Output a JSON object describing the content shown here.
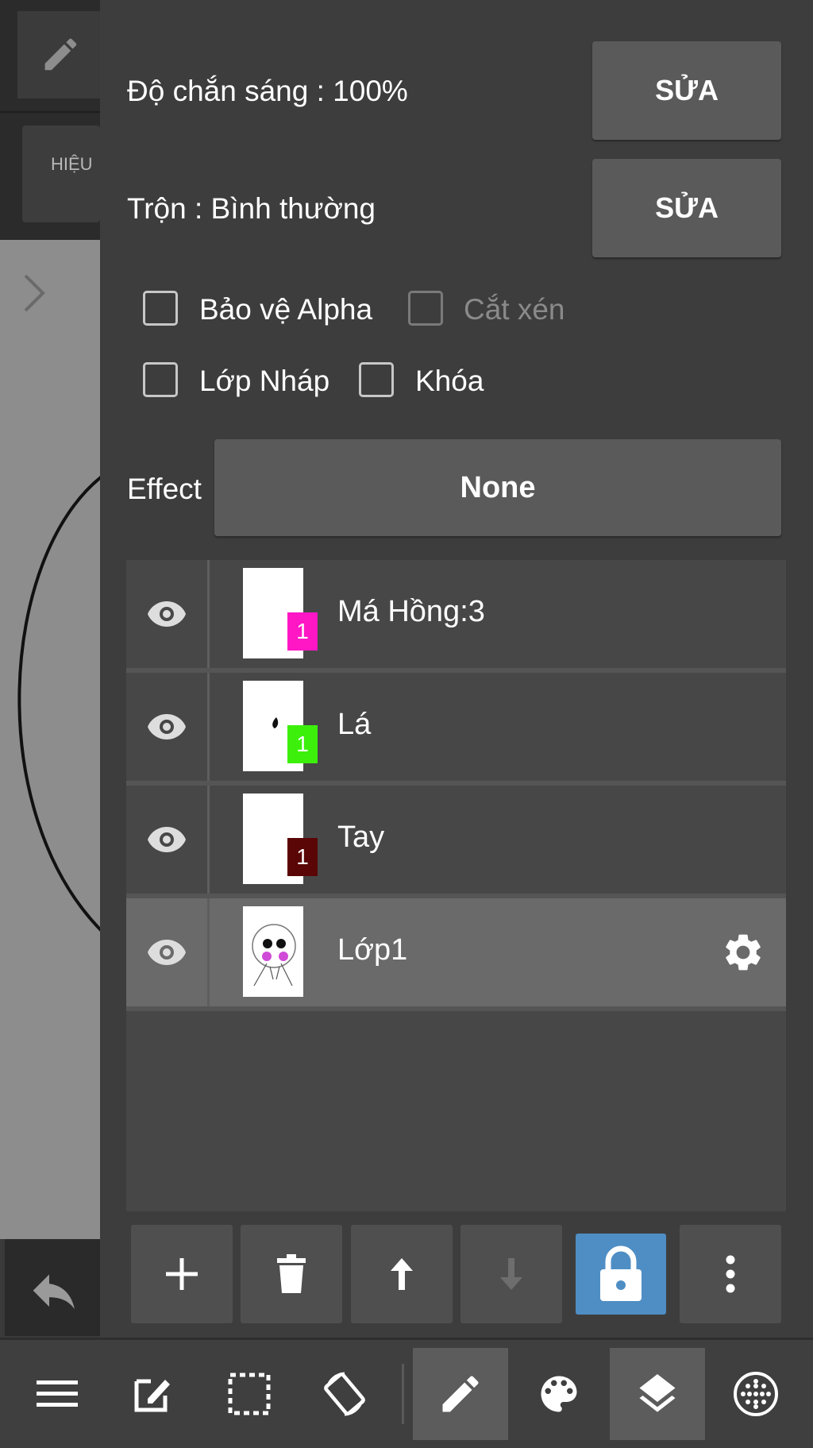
{
  "background": {
    "effect_tile_label": "HIỆU"
  },
  "properties": {
    "opacity_label": "Độ chắn sáng : 100%",
    "blend_label": "Trộn : Bình thường",
    "edit_button": "SỬA",
    "protect_alpha": "Bảo vệ Alpha",
    "clipping": "Cắt xén",
    "draft_layer": "Lớp Nháp",
    "lock": "Khóa",
    "effect_label": "Effect",
    "effect_value": "None"
  },
  "layers": [
    {
      "name": "Má Hồng:3",
      "badge": "1",
      "badge_color": "#ff17c5",
      "visible": true,
      "selected": false
    },
    {
      "name": "Lá",
      "badge": "1",
      "badge_color": "#3cf00c",
      "visible": true,
      "selected": false
    },
    {
      "name": "Tay",
      "badge": "1",
      "badge_color": "#5a0606",
      "visible": true,
      "selected": false
    },
    {
      "name": "Lớp1",
      "badge": "",
      "badge_color": "",
      "visible": true,
      "selected": true
    }
  ],
  "layer_toolbar": [
    "add-icon",
    "trash-icon",
    "arrow-up-icon",
    "arrow-down-icon",
    "lock-icon",
    "more-icon"
  ],
  "bottom_bar": [
    "menu-icon",
    "edit-icon",
    "selection-icon",
    "rotate-icon",
    "pencil-icon",
    "palette-icon",
    "layers-icon",
    "grid-icon"
  ],
  "colors": {
    "lock_active": "#4f8ec4",
    "panel": "#3d3d3d",
    "button": "#5a5a5a"
  }
}
